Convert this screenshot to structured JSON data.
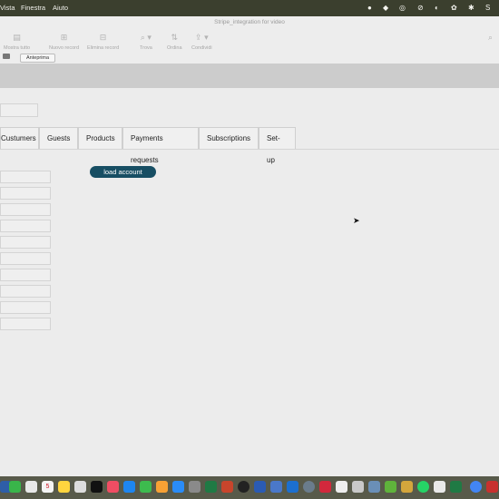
{
  "menubar": {
    "items": [
      "Vista",
      "Finestra",
      "Aiuto"
    ]
  },
  "window": {
    "title": "Stripe_integration for video"
  },
  "toolbar": {
    "buttons": [
      "Mostra tutto",
      "Nuovo record",
      "Elimina record",
      "Trova",
      "Ordina",
      "Condividi"
    ],
    "preview_label": "Anteprima"
  },
  "tabs": [
    "Custumers",
    "Guests",
    "Products",
    "Payments requests",
    "Subscriptions",
    "Set-up"
  ],
  "actions": {
    "load_account_label": "load account"
  },
  "dock": {
    "calendar_day": "5"
  },
  "colors": {
    "accent": "#174e63",
    "menubar": "#3b3f2e",
    "dock": "#585a4a"
  }
}
